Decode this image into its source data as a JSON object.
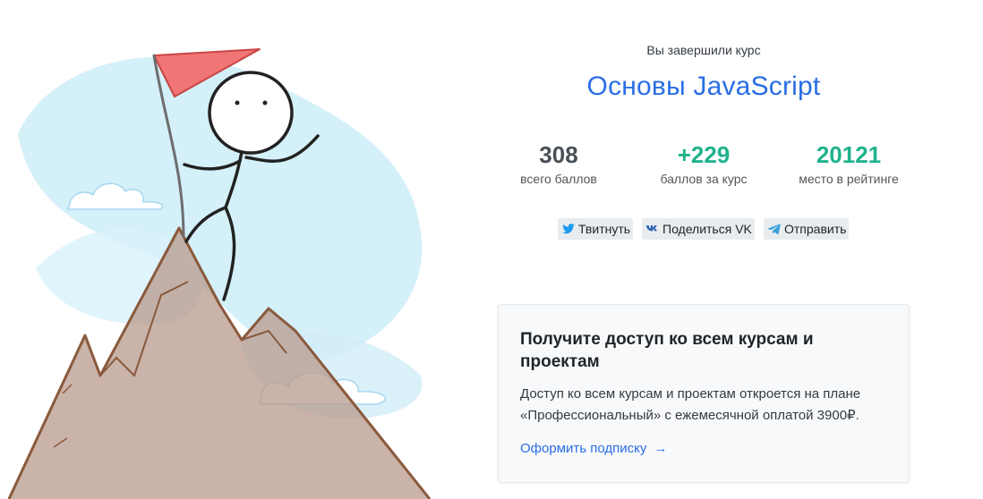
{
  "summary": {
    "completed_label": "Вы завершили курс",
    "course_title": "Основы JavaScript"
  },
  "stats": [
    {
      "value": "308",
      "caption": "всего баллов"
    },
    {
      "value": "+229",
      "caption": "баллов за курс"
    },
    {
      "value": "20121",
      "caption": "место в рейтинге"
    }
  ],
  "share": {
    "tweet_label": "Твитнуть",
    "vk_label": "Поделиться VK",
    "telegram_label": "Отправить",
    "icons": [
      "twitter-icon",
      "vk-icon",
      "telegram-icon"
    ]
  },
  "promo": {
    "title": "Получите доступ ко всем курсам и проектам",
    "text": "Доступ ко всем курсам и проектам откроется на плане «Профессиональный» с ежемесячной оплатой 3900₽.",
    "link_label": "Оформить подписку",
    "link_arrow": "→"
  },
  "colors": {
    "accent_blue": "#2a6ee6",
    "success_green": "#20b28c",
    "flag_red": "#f06b6b",
    "mountain_brown": "#8a5a3c",
    "sky_blue": "#bfe6f5"
  }
}
